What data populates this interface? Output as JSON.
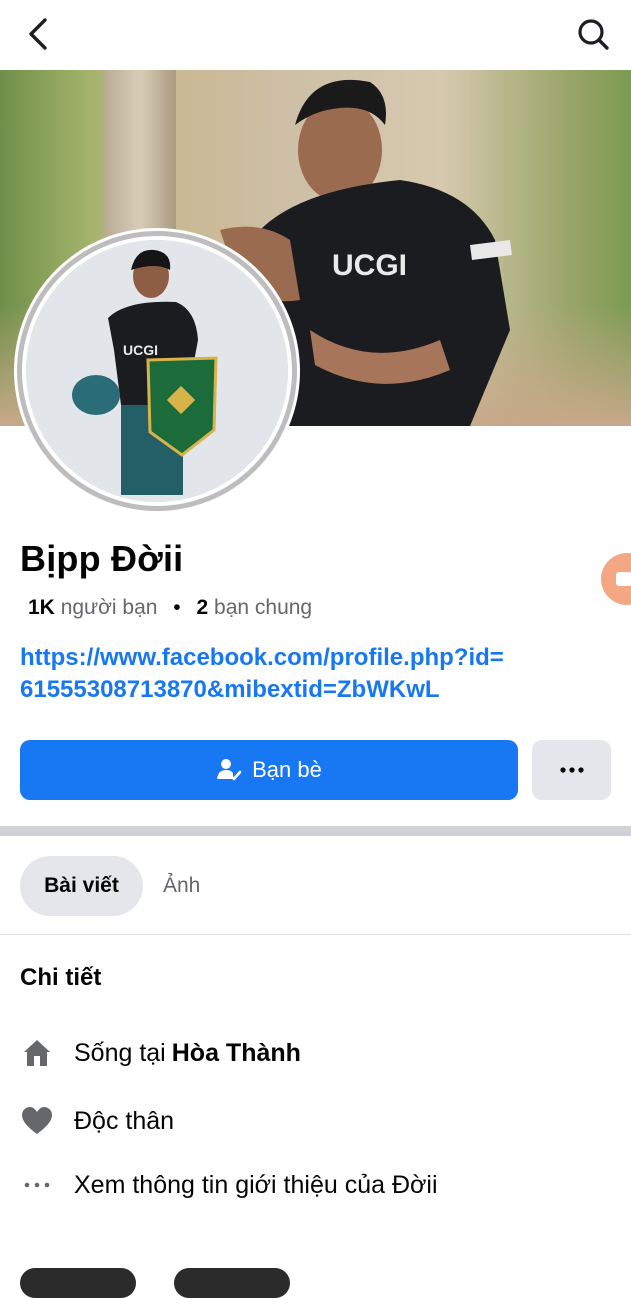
{
  "header": {
    "back_icon": "chevron-left-icon",
    "search_icon": "search-icon"
  },
  "profile": {
    "name": "Bịpp Đờii",
    "friends_count": "1K",
    "friends_label": "người bạn",
    "mutual_count": "2",
    "mutual_label": "bạn chung",
    "separator": "•",
    "link_line1": "https://www.facebook.com/profile.php?id=",
    "link_line2": "61555308713870&mibextid=ZbWKwL"
  },
  "actions": {
    "friends_button": "Bạn bè",
    "more_icon": "more-dots-icon"
  },
  "tabs": [
    {
      "label": "Bài viết",
      "active": true
    },
    {
      "label": "Ảnh",
      "active": false
    }
  ],
  "details": {
    "title": "Chi tiết",
    "lives_prefix": "Sống tại",
    "lives_place": "Hòa Thành",
    "relationship": "Độc thân",
    "see_intro": "Xem thông tin giới thiệu của Đờii"
  },
  "colors": {
    "accent": "#1877f2",
    "muted": "#65676b",
    "chip": "#e4e6eb"
  }
}
